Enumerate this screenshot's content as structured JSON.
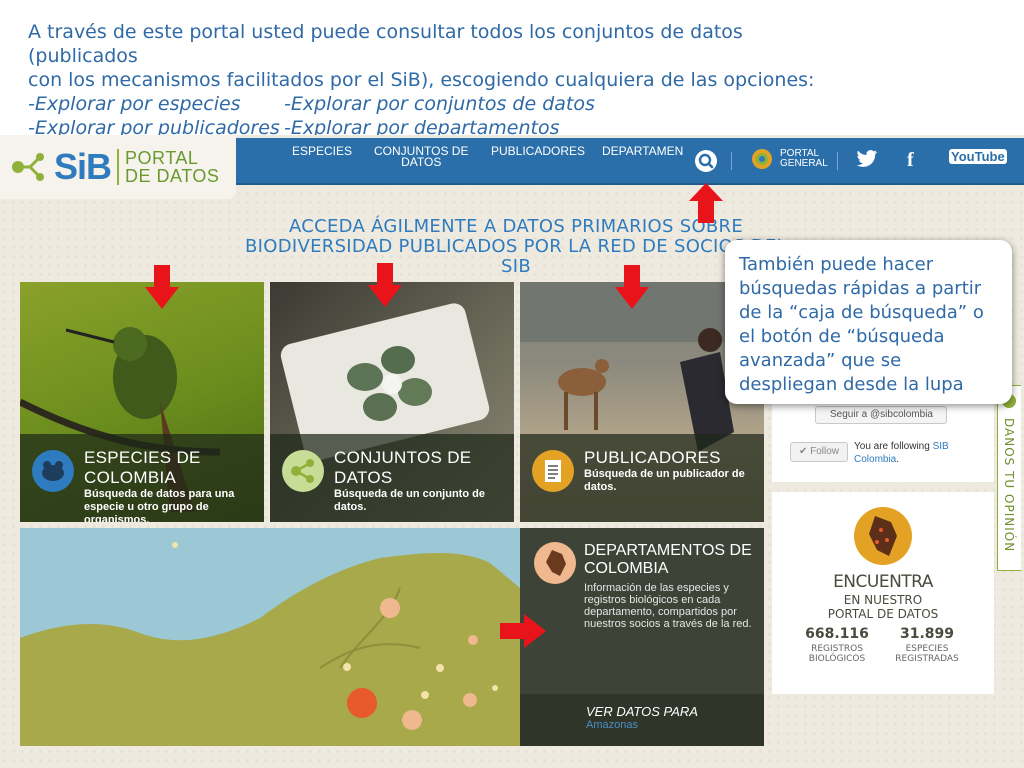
{
  "intro": {
    "line1": "A través de este portal usted puede consultar todos los conjuntos de datos (publicados",
    "line2": "con los mecanismos facilitados por el SiB), escogiendo cualquiera de las opciones:",
    "opt1": "-Explorar por especies",
    "opt2": "-Explorar por conjuntos de datos",
    "opt3": "-Explorar por publicadores",
    "opt4": "-Explorar por departamentos"
  },
  "logo": {
    "sib": "SiB",
    "portal_line1": "PORTAL",
    "portal_line2": "DE DATOS"
  },
  "nav": {
    "especies": "ESPECIES",
    "conjuntos_1": "CONJUNTOS DE",
    "conjuntos_2": "DATOS",
    "publicadores": "PUBLICADORES",
    "departamentos": "DEPARTAMEN",
    "portal_general_1": "PORTAL",
    "portal_general_2": "GENERAL",
    "youtube": "YouTube"
  },
  "headline": {
    "line1": "ACCEDA ÁGILMENTE A DATOS PRIMARIOS SOBRE",
    "line2": "BIODIVERSIDAD PUBLICADOS POR LA RED DE SOCIOS DEL SIB"
  },
  "tiles": [
    {
      "title": "ESPECIES DE COLOMBIA",
      "desc": "Búsqueda de datos para una especie u otro grupo de organismos.",
      "icon": "frog-icon",
      "color": "#2e7cbf"
    },
    {
      "title": "CONJUNTOS DE DATOS",
      "desc": "Búsqueda de un conjunto de datos.",
      "icon": "dataset-icon",
      "color": "#8fb13a"
    },
    {
      "title": "PUBLICADORES",
      "desc": "Búsqueda de un publicador de datos.",
      "icon": "document-icon",
      "color": "#e3a224"
    }
  ],
  "departamentos": {
    "title_1": "DEPARTAMENTOS DE",
    "title_2": "COLOMBIA",
    "desc": "Información de las especies y registros biológicos en cada departamento, compartidos por nuestros socios a través de la red.",
    "ver": "VER DATOS PARA",
    "dept": "Amazonas"
  },
  "twitter": {
    "sigue": "Seguir a @sibcolombia",
    "follow": "✔ Follow",
    "following": "You are following ",
    "sib": "SIB Colombia"
  },
  "encuentra": {
    "title": "ENCUENTRA",
    "sub1": "EN NUESTRO",
    "sub2": "PORTAL DE DATOS",
    "stat1_num": "668.116",
    "stat1_lbl1": "REGISTROS",
    "stat1_lbl2": "BIOLÓGICOS",
    "stat2_num": "31.899",
    "stat2_lbl1": "ESPECIES",
    "stat2_lbl2": "REGISTRADAS"
  },
  "opinion": "DANOS TU OPINIÓN",
  "callout": "También puede hacer búsquedas rápidas a partir de la “caja de búsqueda” o el botón de “búsqueda avanzada”  que se despliegan desde la lupa",
  "colors": {
    "brand_blue": "#2e7cbf",
    "brand_green": "#8fb13a",
    "arrow_red": "#e8141a"
  }
}
